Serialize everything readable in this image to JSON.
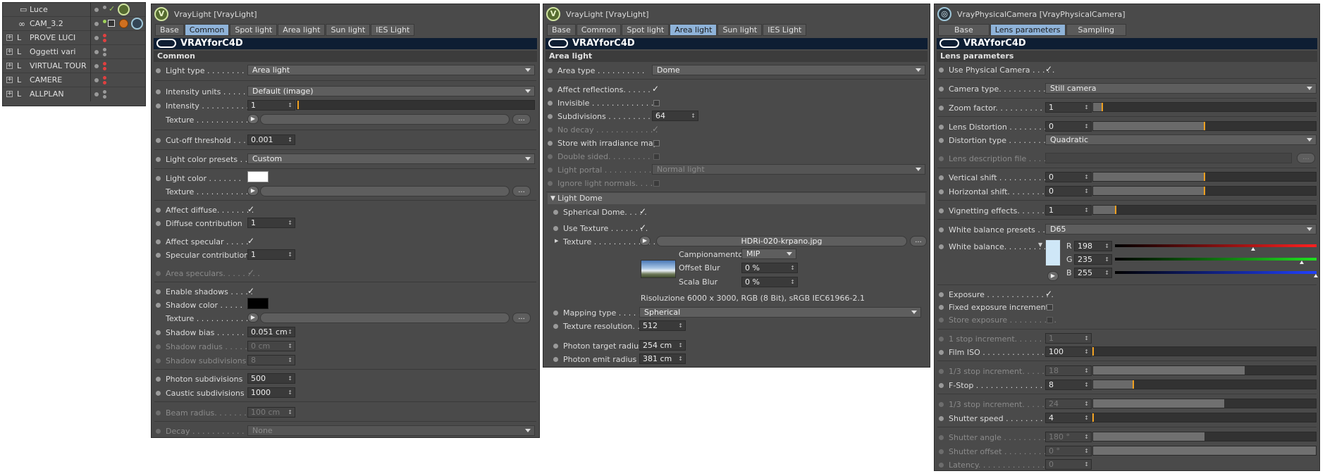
{
  "outliner": {
    "items": [
      "Luce",
      "CAM_3.2",
      "PROVE LUCI",
      "Oggetti vari",
      "VIRTUAL TOUR",
      "CAMERE",
      "ALLPLAN"
    ]
  },
  "p1": {
    "title": "VrayLight [VrayLight]",
    "tabs": [
      "Base",
      "Common",
      "Spot light",
      "Area light",
      "Sun light",
      "IES Light"
    ],
    "banner": "VRAYforC4D",
    "section": "Common",
    "light_type": {
      "label": "Light type . . . . . . . . . .",
      "value": "Area light"
    },
    "intensity_units": {
      "label": "Intensity units . . . . . . .",
      "value": "Default (image)"
    },
    "intensity": {
      "label": "Intensity . . . . . . . . . . . .",
      "value": "1"
    },
    "texture_label": "Texture . . . . . . . . . . . .",
    "cutoff": {
      "label": "Cut-off threshold . . .",
      "value": "0.001"
    },
    "color_presets": {
      "label": "Light color presets . .",
      "value": "Custom"
    },
    "light_color": {
      "label": "Light color . . . . . . ."
    },
    "texture2_label": "Texture . . . . . . . . . . .",
    "affect_diffuse": {
      "label": "Affect diffuse. . . . . . . .",
      "check": "✓"
    },
    "diffuse_contrib": {
      "label": "Diffuse contribution",
      "value": "1"
    },
    "affect_specular": {
      "label": "Affect specular . . . . .",
      "check": "✓"
    },
    "specular_contrib": {
      "label": "Specular contribution",
      "value": "1"
    },
    "area_speculars": {
      "label": "Area speculars. . . . . . . .",
      "check": "✓"
    },
    "enable_shadows": {
      "label": "Enable shadows . . . . .",
      "check": "✓"
    },
    "shadow_color": {
      "label": "Shadow color . . . . ."
    },
    "texture3_label": "Texture . . . . . . . . . . . . .",
    "shadow_bias": {
      "label": "Shadow bias . . . . . . . .",
      "value": "0.051 cm"
    },
    "shadow_radius": {
      "label": "Shadow radius . . . . . . .",
      "value": "0 cm"
    },
    "shadow_subdiv": {
      "label": "Shadow subdivisions",
      "value": "8"
    },
    "photon_subdiv": {
      "label": "Photon subdivisions",
      "value": "500"
    },
    "caustic_subdiv": {
      "label": "Caustic subdivisions",
      "value": "1000"
    },
    "beam_radius": {
      "label": "Beam radius. . . . . . . . . .",
      "value": "100 cm"
    },
    "decay": {
      "label": "Decay . . . . . . . . . . . . .",
      "value": "None"
    }
  },
  "p2": {
    "title": "VrayLight [VrayLight]",
    "tabs": [
      "Base",
      "Common",
      "Spot light",
      "Area light",
      "Sun light",
      "IES Light"
    ],
    "banner": "VRAYforC4D",
    "section": "Area light",
    "area_type": {
      "label": "Area type . . . . . . . . . .",
      "value": "Dome"
    },
    "affect_reflections": {
      "label": "Affect reflections. . . . . .",
      "check": "✓"
    },
    "invisible": {
      "label": "Invisible . . . . . . . . . . . . ."
    },
    "subdivisions": {
      "label": "Subdivisions . . . . . . . . . . .",
      "value": "64"
    },
    "no_decay": {
      "label": "No decay . . . . . . . . . . . . .",
      "check": "✓"
    },
    "store_irradiance": {
      "label": "Store with irradiance map"
    },
    "double_sided": {
      "label": "Double sided. . . . . . . . . . ."
    },
    "light_portal": {
      "label": "Light portal . . . . . . . . . . .",
      "value": "Normal light"
    },
    "ignore_normals": {
      "label": "Ignore light normals. . . . ."
    },
    "dome_header": "Light Dome",
    "spherical_dome": {
      "label": "Spherical Dome. . . . .",
      "check": "✓"
    },
    "use_texture": {
      "label": "Use Texture . . . . . . . .",
      "check": "✓"
    },
    "texture": {
      "label": "Texture . . . . . . . . . . . . .",
      "value": "HDRi-020-krpano.jpg"
    },
    "campionamento": {
      "label": "Campionamento",
      "value": "MIP"
    },
    "offset_blur": {
      "label": "Offset Blur",
      "value": "0 %"
    },
    "scala_blur": {
      "label": "Scala Blur",
      "value": "0 %"
    },
    "resolution_info": "Risoluzione 6000 x 3000, RGB (8 Bit), sRGB IEC61966-2.1",
    "mapping_type": {
      "label": "Mapping type . . . . . .",
      "value": "Spherical"
    },
    "texture_resolution": {
      "label": "Texture resolution. . . .",
      "value": "512"
    },
    "photon_target": {
      "label": "Photon target radius",
      "value": "254 cm"
    },
    "photon_emit": {
      "label": "Photon emit radius",
      "value": "381 cm"
    }
  },
  "p3": {
    "title": "VrayPhysicalCamera [VrayPhysicalCamera]",
    "tabs": [
      "Base",
      "Lens parameters",
      "Sampling"
    ],
    "banner": "VRAYforC4D",
    "section": "Lens parameters",
    "use_physical": {
      "label": "Use Physical Camera . . . . .",
      "check": "✓"
    },
    "camera_type": {
      "label": "Camera type. . . . . . . . . . . .",
      "value": "Still camera"
    },
    "zoom_factor": {
      "label": "Zoom factor. . . . . . . . . . . . .",
      "value": "1",
      "level": 0.04
    },
    "lens_distortion": {
      "label": "Lens Distortion . . . . . . . . .",
      "value": "0",
      "level": 0.5
    },
    "distortion_type": {
      "label": "Distortion type . . . . . . . . .",
      "value": "Quadratic"
    },
    "lens_desc": {
      "label": "Lens description file . . . . . ."
    },
    "vertical_shift": {
      "label": "Vertical shift . . . . . . . . . . .",
      "value": "0",
      "level": 0.5
    },
    "horizontal_shift": {
      "label": "Horizontal shift. . . . . . . . .",
      "value": "0",
      "level": 0.5
    },
    "vignetting": {
      "label": "Vignetting effects. . . . . . . .",
      "value": "1",
      "level": 0.1
    },
    "wb_presets": {
      "label": "White balance presets . . . .",
      "value": "D65"
    },
    "white_balance": {
      "label": "White balance. . . . . . . . . .",
      "swatch": "#cfe7f7",
      "r": "198",
      "g": "235",
      "b": "255",
      "r_label": "R",
      "g_label": "G",
      "b_label": "B"
    },
    "exposure": {
      "label": "Exposure . . . . . . . . . . . . . .",
      "check": "✓"
    },
    "fixed_exposure": {
      "label": "Fixed exposure increments"
    },
    "store_exposure": {
      "label": "Store exposure . . . . . . . . . ."
    },
    "one_stop": {
      "label": "1 stop increment. . . . . . . .",
      "value": "1"
    },
    "film_iso": {
      "label": "Film ISO . . . . . . . . . . . . . . .",
      "value": "100",
      "level": 0.0
    },
    "third_stop_iso": {
      "label": "1/3 stop increment. . . . . . .",
      "value": "18",
      "level": 0.68
    },
    "fstop": {
      "label": "F-Stop . . . . . . . . . . . . . . . . .",
      "value": "8",
      "level": 0.18
    },
    "third_stop_shutter": {
      "label": "1/3 stop increment. . . . . . .",
      "value": "24",
      "level": 0.59
    },
    "shutter_speed": {
      "label": "Shutter speed . . . . . . . . . .",
      "value": "4",
      "level": 0.0
    },
    "shutter_angle": {
      "label": "Shutter angle . . . . . . . . . . .",
      "value": "180 °",
      "level": 0.5
    },
    "shutter_offset": {
      "label": "Shutter offset . . . . . . . . . .",
      "value": "0 °",
      "level": 1.0
    },
    "latency": {
      "label": "Latency. . . . . . . . . . . . . . . .",
      "value": "0"
    }
  }
}
